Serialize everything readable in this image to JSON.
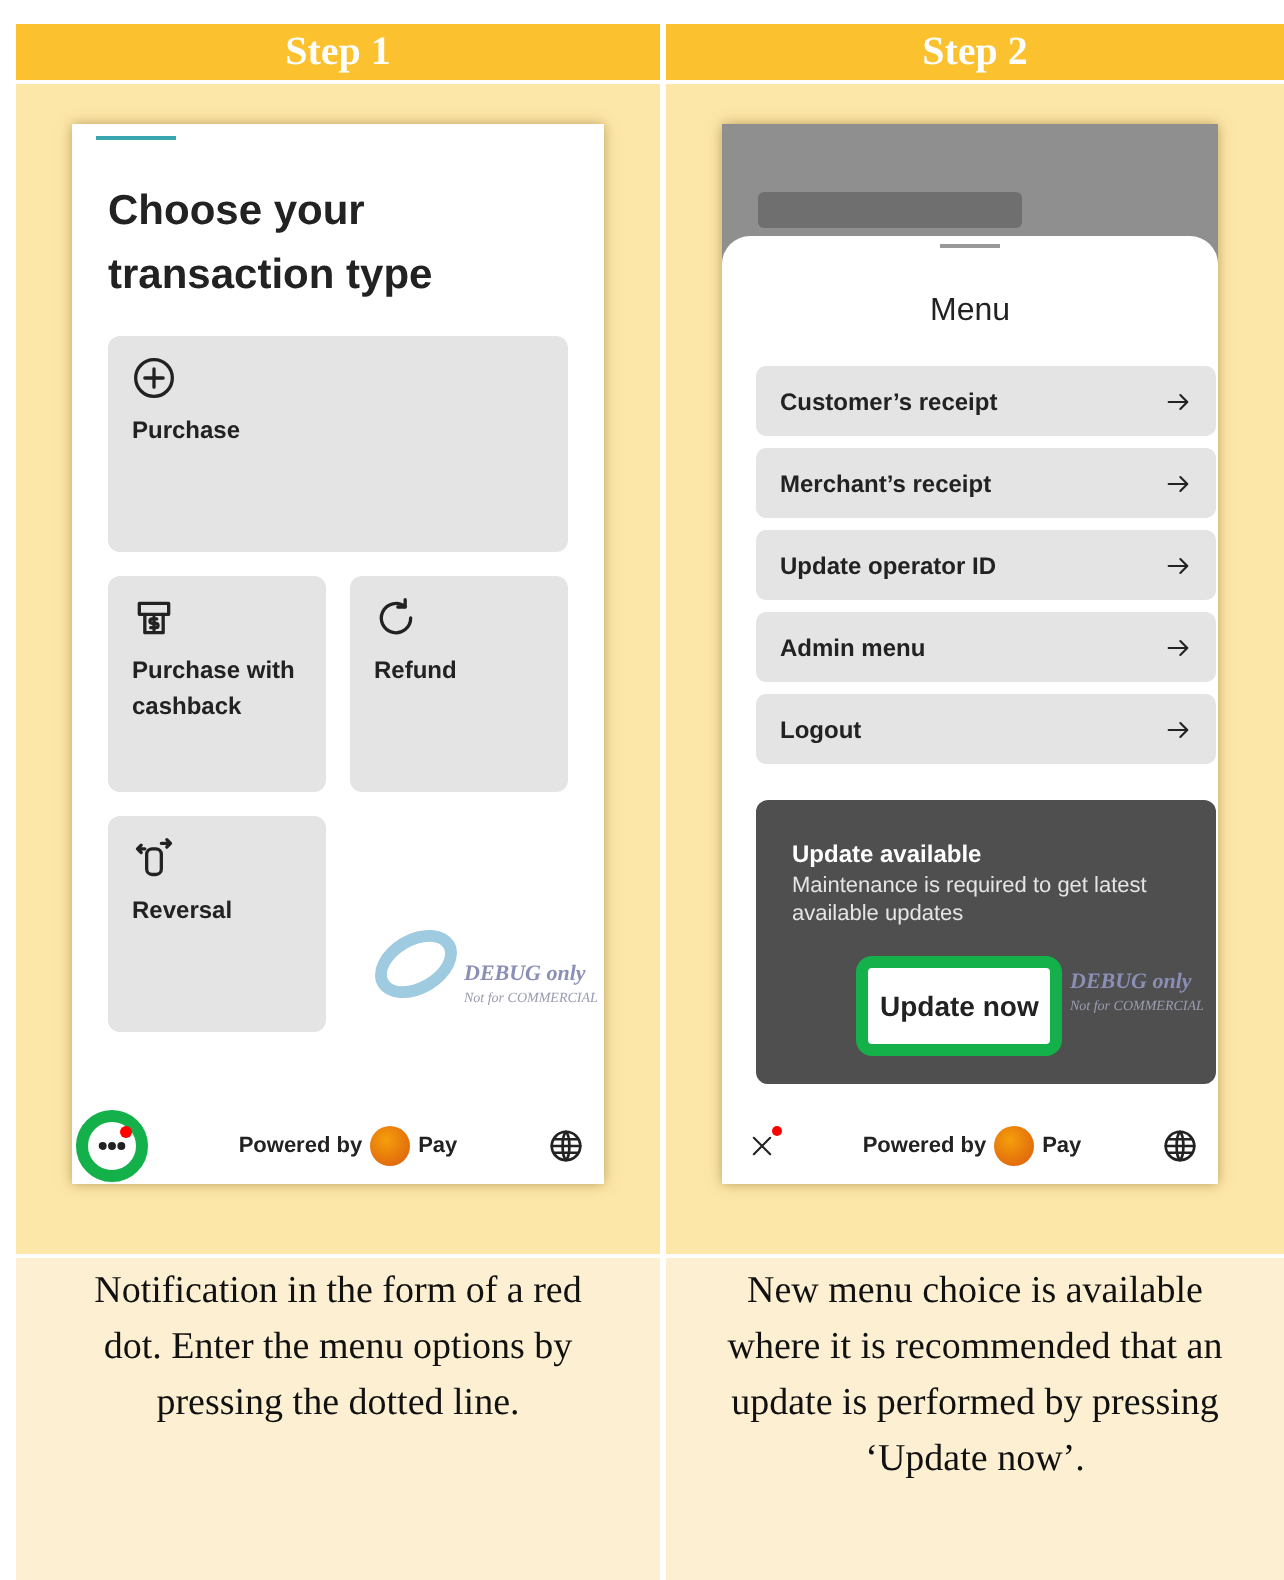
{
  "columns": [
    {
      "header": "Step 1",
      "screen": {
        "kind": "transactions",
        "title": "Choose your transaction type",
        "tiles": [
          {
            "label": "Purchase"
          },
          {
            "label": "Purchase with cashback"
          },
          {
            "label": "Refund"
          },
          {
            "label": "Reversal"
          }
        ],
        "debug_mark": "DEBUG only",
        "debug_note": "Not for COMMERCIAL",
        "footer": {
          "menu_button": {
            "notification": true,
            "highlighted": true
          },
          "powered_by": "Powered by",
          "brand": "Pay"
        }
      },
      "caption": "Notification in the form of a red dot. Enter the menu options by pressing the dotted line."
    },
    {
      "header": "Step 2",
      "screen": {
        "kind": "menu",
        "title": "Menu",
        "items": [
          {
            "label": "Customer’s receipt"
          },
          {
            "label": "Merchant’s receipt"
          },
          {
            "label": "Update operator ID"
          },
          {
            "label": "Admin menu"
          },
          {
            "label": "Logout"
          }
        ],
        "update_card": {
          "title": "Update available",
          "text": "Maintenance is required to get latest available updates",
          "button": {
            "label": "Update now",
            "highlighted": true
          }
        },
        "debug_mark": "DEBUG only",
        "debug_note": "Not for COMMERCIAL",
        "footer": {
          "close_button": {
            "notification": true
          },
          "powered_by": "Powered by",
          "brand": "Pay"
        }
      },
      "caption": "New menu choice is available where it is recommended that an update is performed by pressing ‘Update now’."
    }
  ]
}
